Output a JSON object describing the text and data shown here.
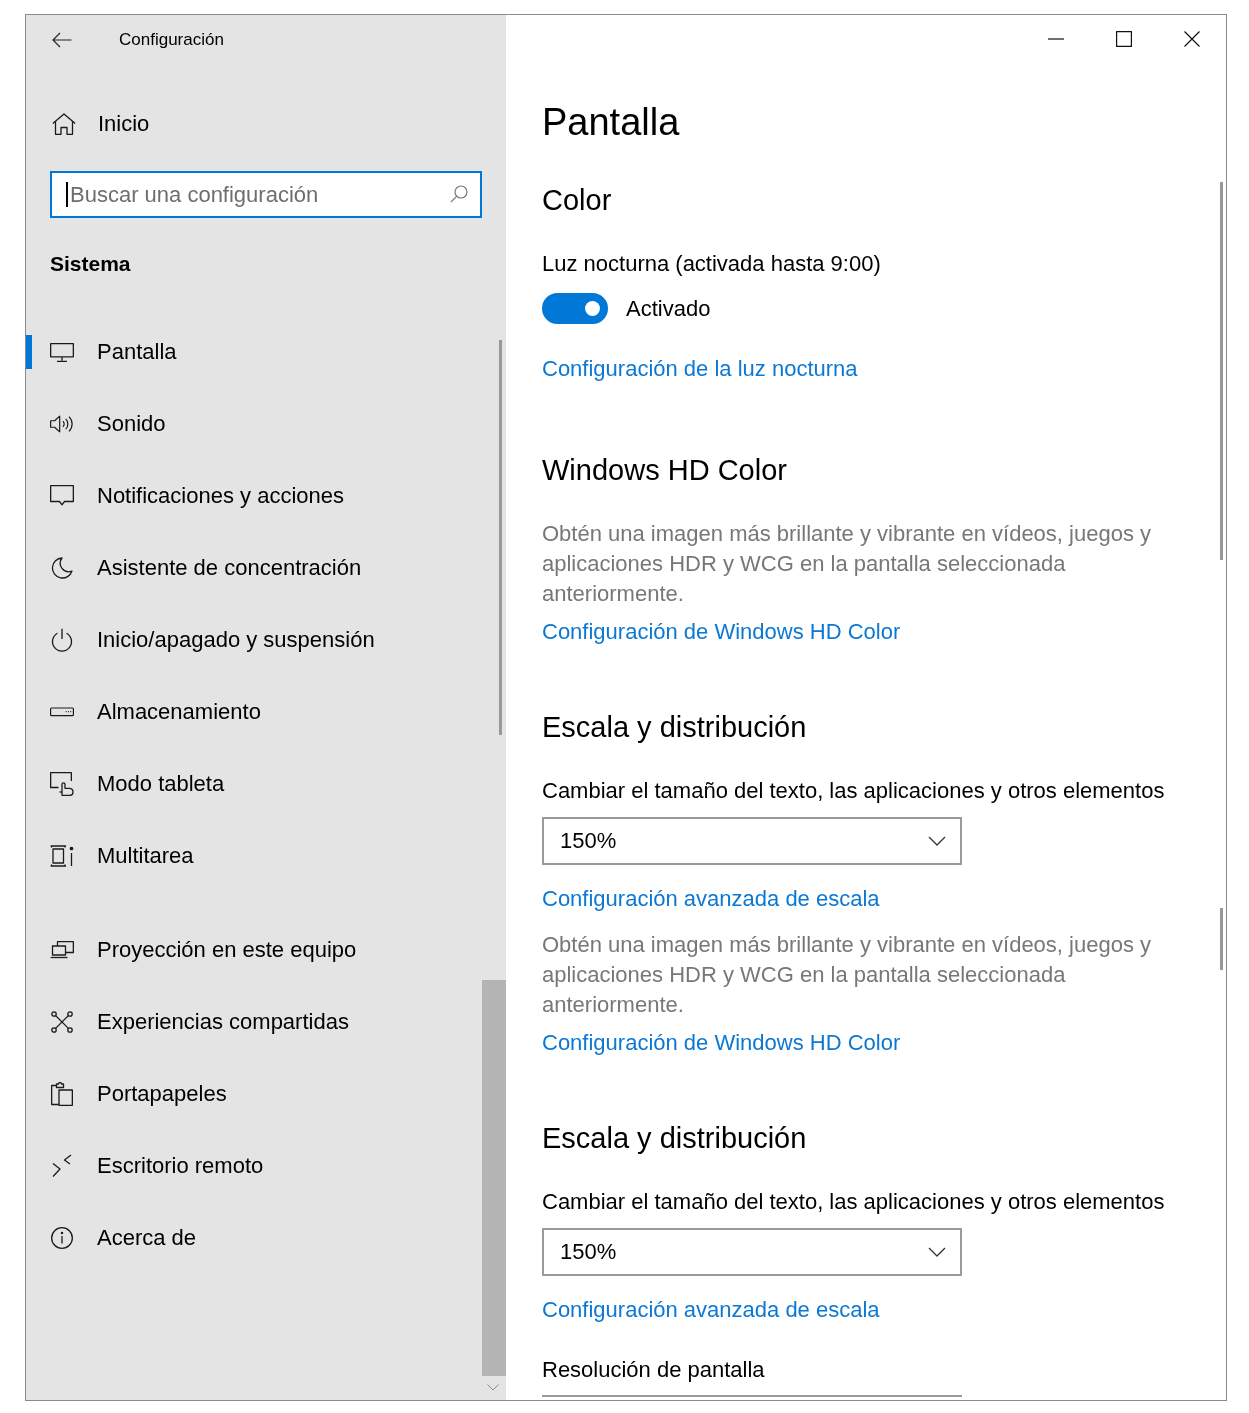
{
  "window": {
    "title": "Configuración"
  },
  "sidebar": {
    "home": {
      "label": "Inicio"
    },
    "search": {
      "placeholder": "Buscar una configuración"
    },
    "heading": "Sistema",
    "groups": [
      {
        "items": [
          {
            "label": "Pantalla",
            "selected": true
          },
          {
            "label": "Sonido",
            "selected": false
          },
          {
            "label": "Notificaciones y acciones",
            "selected": false
          },
          {
            "label": "Asistente de concentración",
            "selected": false
          },
          {
            "label": "Inicio/apagado y suspensión",
            "selected": false
          },
          {
            "label": "Almacenamiento",
            "selected": false
          },
          {
            "label": "Modo tableta",
            "selected": false
          },
          {
            "label": "Multitarea",
            "selected": false
          }
        ]
      },
      {
        "items": [
          {
            "label": "Proyección en este equipo",
            "selected": false
          },
          {
            "label": "Experiencias compartidas",
            "selected": false
          },
          {
            "label": "Portapapeles",
            "selected": false
          },
          {
            "label": "Escritorio remoto",
            "selected": false
          },
          {
            "label": "Acerca de",
            "selected": false
          }
        ]
      }
    ]
  },
  "page": {
    "title": "Pantalla",
    "sections": [
      {
        "title": "Color",
        "items": [
          {
            "kind": "label",
            "text": "Luz nocturna (activada hasta 9:00)"
          },
          {
            "kind": "toggle",
            "on": true,
            "label": "Activado"
          },
          {
            "kind": "link",
            "text": "Configuración de la luz nocturna"
          }
        ]
      },
      {
        "title": "Windows HD Color",
        "items": [
          {
            "kind": "description",
            "text": "Obtén una imagen más brillante y vibrante en vídeos, juegos y aplicaciones HDR y WCG en la pantalla seleccionada anteriormente."
          },
          {
            "kind": "link",
            "text": "Configuración de Windows HD Color"
          }
        ]
      },
      {
        "title": "Escala y distribución",
        "items": [
          {
            "kind": "label",
            "text": "Cambiar el tamaño del texto, las aplicaciones y otros elementos"
          },
          {
            "kind": "dropdown",
            "value": "150%"
          },
          {
            "kind": "link",
            "text": "Configuración avanzada de escala"
          },
          {
            "kind": "description",
            "text": "Obtén una imagen más brillante y vibrante en vídeos, juegos y aplicaciones HDR y WCG en la pantalla seleccionada anteriormente."
          },
          {
            "kind": "link",
            "text": "Configuración de Windows HD Color"
          }
        ]
      },
      {
        "title": "Escala y distribución",
        "items": [
          {
            "kind": "label",
            "text": "Cambiar el tamaño del texto, las aplicaciones y otros elementos"
          },
          {
            "kind": "dropdown",
            "value": "150%"
          },
          {
            "kind": "link",
            "text": "Configuración avanzada de escala"
          },
          {
            "kind": "label",
            "text": "Resolución de pantalla"
          },
          {
            "kind": "dropdown"
          }
        ]
      }
    ]
  }
}
